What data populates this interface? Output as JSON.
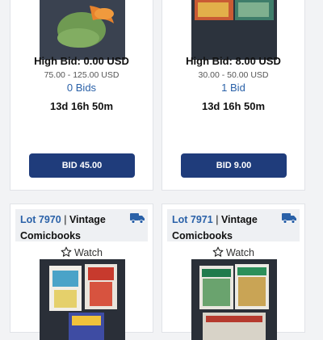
{
  "cards_top": [
    {
      "high_bid": "High Bid: 0.00 USD",
      "estimate": "75.00 - 125.00 USD",
      "bids": "0 Bids",
      "time_left": "13d 16h 50m",
      "bid_button": "BID 45.00"
    },
    {
      "high_bid": "High Bid: 8.00 USD",
      "estimate": "30.00 - 50.00 USD",
      "bids": "1 Bid",
      "time_left": "13d 16h 50m",
      "bid_button": "BID 9.00"
    }
  ],
  "cards_bottom": [
    {
      "lot_number": "Lot 7970",
      "separator": "|",
      "title_part1": "Vintage",
      "title_part2": "Comicbooks",
      "watch_label": "Watch"
    },
    {
      "lot_number": "Lot 7971",
      "separator": "|",
      "title_part1": "Vintage",
      "title_part2": "Comicbooks",
      "watch_label": "Watch"
    }
  ],
  "icons": {
    "truck": "truck-icon",
    "watch": "star-outline-icon"
  },
  "colors": {
    "accent": "#2a61a8",
    "button": "#1f3c7b",
    "truck": "#2a61a8"
  }
}
